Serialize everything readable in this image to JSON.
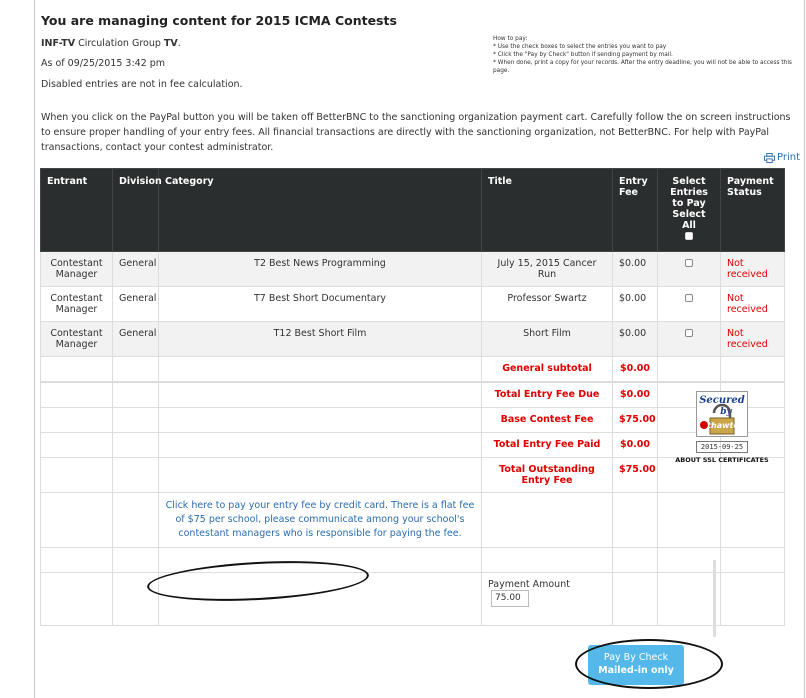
{
  "header": {
    "title": "You are managing content for 2015 ICMA Contests",
    "org_name": "INF-TV",
    "org_mid": " Circulation Group ",
    "org_tail": "TV",
    "org_end": ".",
    "asof": "As of 09/25/2015 3:42 pm",
    "disabled_note": "Disabled entries are not in fee calculation."
  },
  "howto": [
    "How to pay:",
    "* Use the check boxes to select the entries you want to pay",
    "* Click the \"Pay by Check\" button if sending payment by mail.",
    "* When done, print a copy for your records. After the entry deadline, you will not be able to access this page."
  ],
  "notice": "When you click on the PayPal button you will be taken off BetterBNC to the sanctioning organization payment cart. Carefully follow the on screen instructions to ensure proper handling of your entry fees. All financial transactions are directly with the sanctioning organization, not BetterBNC. For help with PayPal transactions, contact your contest administrator.",
  "print_label": "Print",
  "table": {
    "headers": {
      "entrant": "Entrant",
      "division": "Division",
      "category": "Category",
      "title": "Title",
      "fee": "Entry Fee",
      "select": "Select Entries to Pay",
      "select_all": "Select All",
      "status": "Payment Status"
    },
    "rows": [
      {
        "entrant": "Contestant Manager",
        "division": "General",
        "category": "T2 Best News Programming",
        "title": "July 15, 2015 Cancer Run",
        "fee": "$0.00",
        "status": "Not received"
      },
      {
        "entrant": "Contestant Manager",
        "division": "General",
        "category": "T7 Best Short Documentary",
        "title": "Professor Swartz",
        "fee": "$0.00",
        "status": "Not received"
      },
      {
        "entrant": "Contestant Manager",
        "division": "General",
        "category": "T12 Best Short Film",
        "title": "Short Film",
        "fee": "$0.00",
        "status": "Not received"
      }
    ],
    "subtotal_label": "General subtotal",
    "subtotal_value": "$0.00",
    "totals": [
      {
        "label": "Total Entry Fee Due",
        "value": "$0.00"
      },
      {
        "label": "Base Contest Fee",
        "value": "$75.00"
      },
      {
        "label": "Total Entry Fee Paid",
        "value": "$0.00"
      },
      {
        "label": "Total Outstanding Entry Fee",
        "value": "$75.00"
      }
    ],
    "pay_link": "Click here to pay your entry fee by credit card. There is a flat fee of $75 per school, please communicate among your school's contestant managers who is responsible for paying the fee.",
    "amount_label": "Payment Amount",
    "amount_value": "75.00"
  },
  "seal": {
    "line1": "Secured",
    "line2": "by",
    "brand": "thawte",
    "date": "2015-09-25",
    "about": "ABOUT SSL CERTIFICATES"
  },
  "pay_button": {
    "line1": "Pay By Check",
    "line2": "Mailed-in only"
  },
  "colors": {
    "header_bg": "#2b2e2e",
    "accent_red": "#e00000",
    "link_blue": "#2a6db0",
    "button_blue": "#55b8ea"
  }
}
